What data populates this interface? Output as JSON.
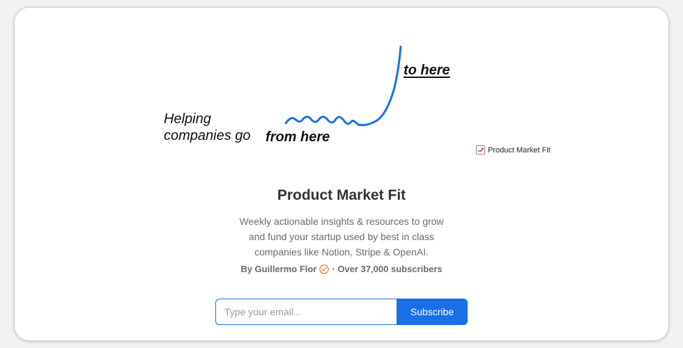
{
  "hero": {
    "line1": "Helping",
    "line2": "companies go",
    "from_here": "from here",
    "to_here": "to here",
    "curve_color": "#1a6fe8"
  },
  "brand_tag": {
    "icon": "chart-icon",
    "label": "Product Market Fit"
  },
  "title": "Product Market Fit",
  "description": "Weekly actionable insights & resources to grow and fund your startup used by best in class companies like Notion, Stripe & OpenAI.",
  "byline": {
    "author": "By Guillermo Flor",
    "verified_icon": "verified-badge-icon",
    "subscribers": "· Over 37,000 subscribers"
  },
  "form": {
    "email_placeholder": "Type your email...",
    "email_value": "",
    "subscribe_label": "Subscribe"
  },
  "colors": {
    "accent": "#1a6fe8",
    "verified": "#e8873a"
  }
}
